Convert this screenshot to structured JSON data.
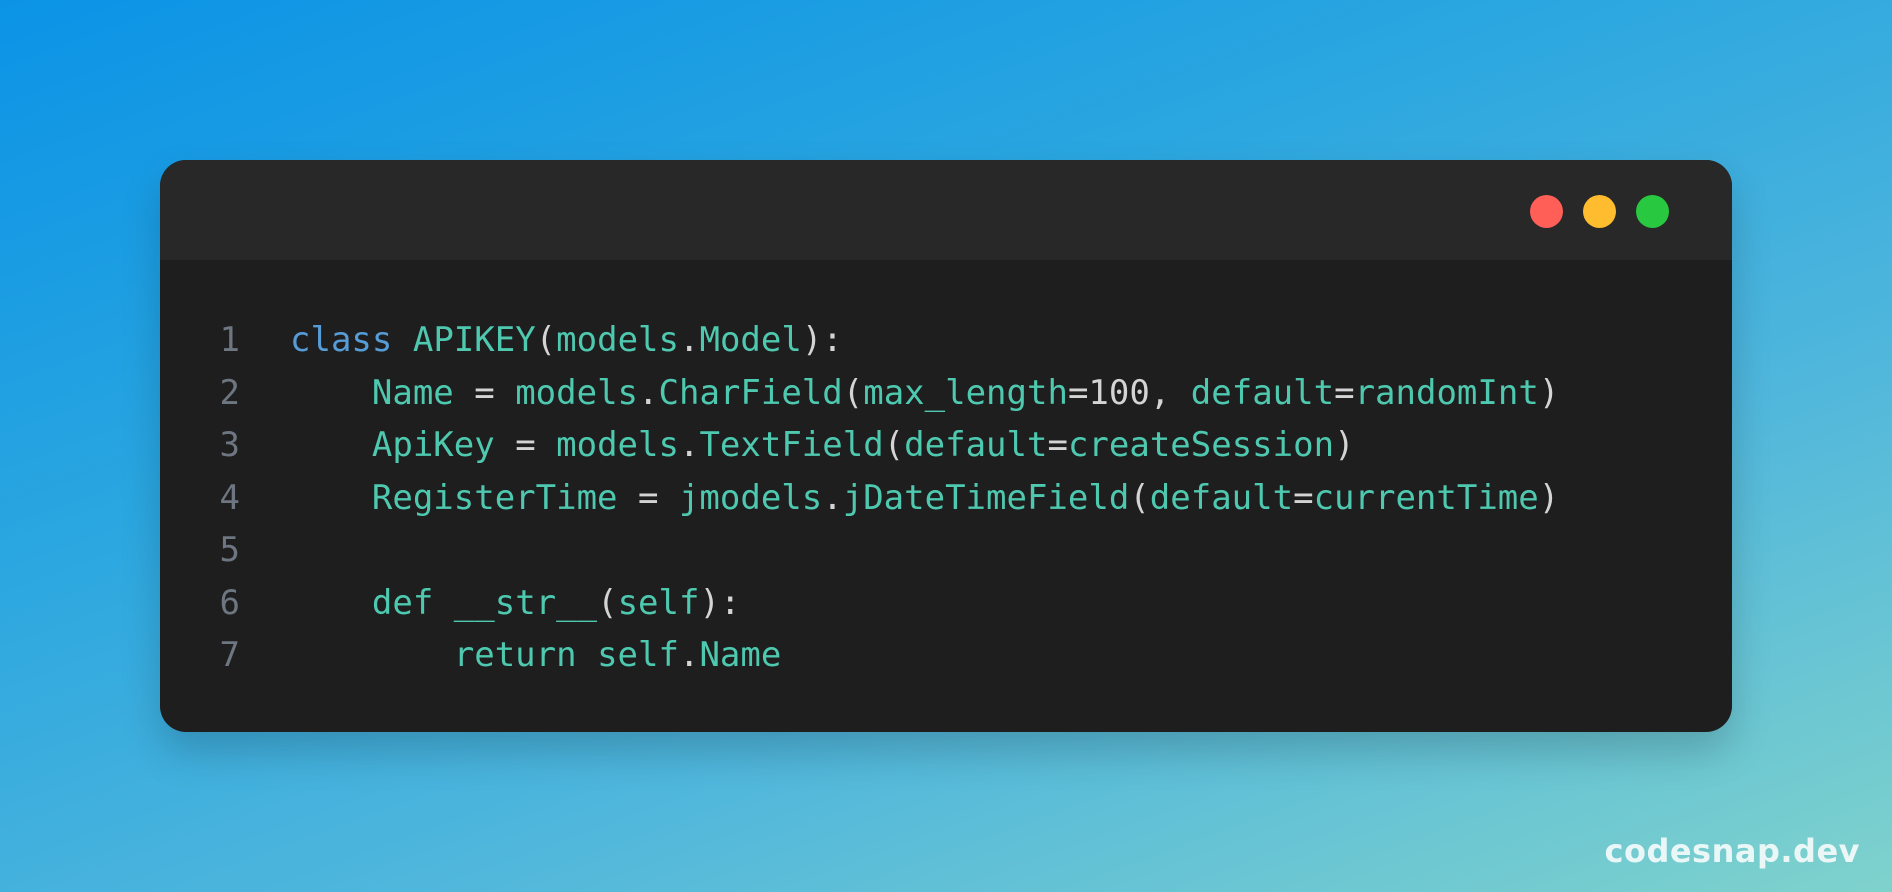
{
  "colors": {
    "close": "#ff5f57",
    "minimize": "#febc2e",
    "maximize": "#28c840",
    "keyword": "#569cd6",
    "identifier": "#4ec9b0",
    "punctuation": "#d4d4d4",
    "line_number": "#6e7681",
    "window_bg": "#1e1e1e",
    "titlebar_bg": "#282828"
  },
  "code": {
    "lines": [
      {
        "number": "1",
        "tokens": [
          {
            "t": "class",
            "c": "kw"
          },
          {
            "t": " ",
            "c": "pn"
          },
          {
            "t": "APIKEY",
            "c": "id"
          },
          {
            "t": "(",
            "c": "pn"
          },
          {
            "t": "models",
            "c": "id"
          },
          {
            "t": ".",
            "c": "pn"
          },
          {
            "t": "Model",
            "c": "id"
          },
          {
            "t": "):",
            "c": "pn"
          }
        ]
      },
      {
        "number": "2",
        "tokens": [
          {
            "t": "    ",
            "c": "pn"
          },
          {
            "t": "Name",
            "c": "id"
          },
          {
            "t": " = ",
            "c": "pn"
          },
          {
            "t": "models",
            "c": "id"
          },
          {
            "t": ".",
            "c": "pn"
          },
          {
            "t": "CharField",
            "c": "id"
          },
          {
            "t": "(",
            "c": "pn"
          },
          {
            "t": "max_length",
            "c": "id"
          },
          {
            "t": "=",
            "c": "pn"
          },
          {
            "t": "100",
            "c": "nm"
          },
          {
            "t": ", ",
            "c": "pn"
          },
          {
            "t": "default",
            "c": "id"
          },
          {
            "t": "=",
            "c": "pn"
          },
          {
            "t": "randomInt",
            "c": "id"
          },
          {
            "t": ")",
            "c": "pn"
          }
        ]
      },
      {
        "number": "3",
        "tokens": [
          {
            "t": "    ",
            "c": "pn"
          },
          {
            "t": "ApiKey",
            "c": "id"
          },
          {
            "t": " = ",
            "c": "pn"
          },
          {
            "t": "models",
            "c": "id"
          },
          {
            "t": ".",
            "c": "pn"
          },
          {
            "t": "TextField",
            "c": "id"
          },
          {
            "t": "(",
            "c": "pn"
          },
          {
            "t": "default",
            "c": "id"
          },
          {
            "t": "=",
            "c": "pn"
          },
          {
            "t": "createSession",
            "c": "id"
          },
          {
            "t": ")",
            "c": "pn"
          }
        ]
      },
      {
        "number": "4",
        "tokens": [
          {
            "t": "    ",
            "c": "pn"
          },
          {
            "t": "RegisterTime",
            "c": "id"
          },
          {
            "t": " = ",
            "c": "pn"
          },
          {
            "t": "jmodels",
            "c": "id"
          },
          {
            "t": ".",
            "c": "pn"
          },
          {
            "t": "jDateTimeField",
            "c": "id"
          },
          {
            "t": "(",
            "c": "pn"
          },
          {
            "t": "default",
            "c": "id"
          },
          {
            "t": "=",
            "c": "pn"
          },
          {
            "t": "currentTime",
            "c": "id"
          },
          {
            "t": ")",
            "c": "pn"
          }
        ]
      },
      {
        "number": "5",
        "tokens": []
      },
      {
        "number": "6",
        "tokens": [
          {
            "t": "    ",
            "c": "pn"
          },
          {
            "t": "def",
            "c": "id"
          },
          {
            "t": " ",
            "c": "pn"
          },
          {
            "t": "__str__",
            "c": "id"
          },
          {
            "t": "(",
            "c": "pn"
          },
          {
            "t": "self",
            "c": "id"
          },
          {
            "t": "):",
            "c": "pn"
          }
        ]
      },
      {
        "number": "7",
        "tokens": [
          {
            "t": "        ",
            "c": "pn"
          },
          {
            "t": "return",
            "c": "id"
          },
          {
            "t": " ",
            "c": "pn"
          },
          {
            "t": "self",
            "c": "id"
          },
          {
            "t": ".",
            "c": "pn"
          },
          {
            "t": "Name",
            "c": "id"
          }
        ]
      }
    ]
  },
  "watermark": {
    "text": "codesnap.dev"
  }
}
